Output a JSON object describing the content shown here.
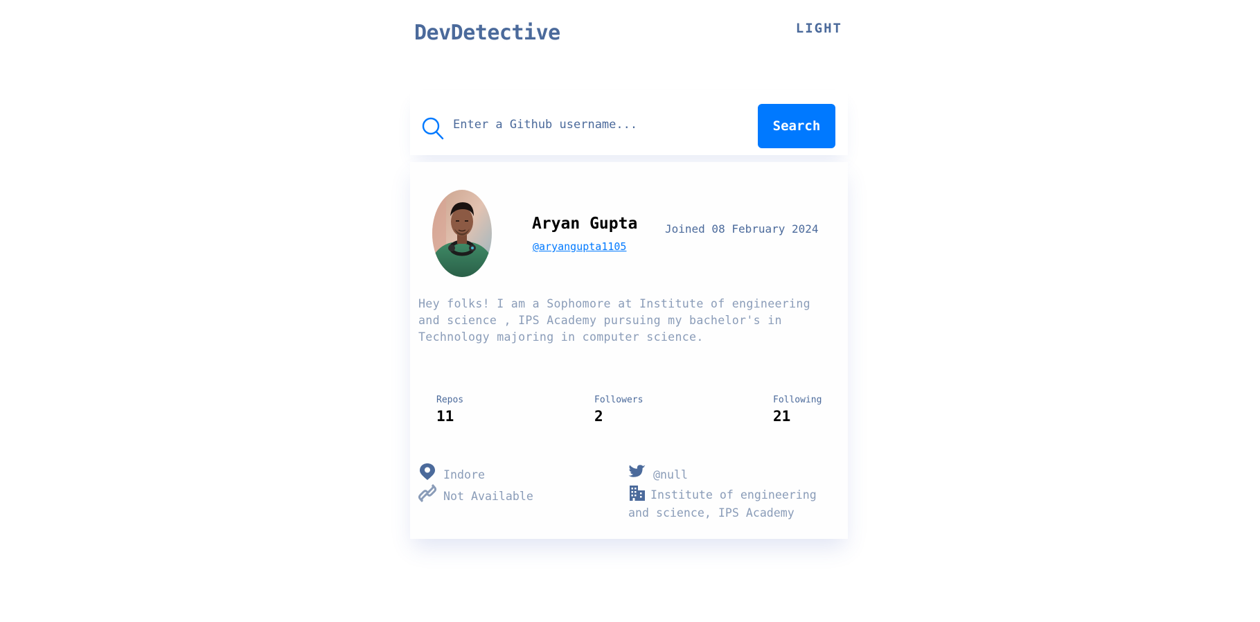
{
  "header": {
    "logo": "DevDetective",
    "mode_toggle": "LIGHT"
  },
  "search": {
    "placeholder": "Enter a Github username...",
    "value": "",
    "button_label": "Search"
  },
  "profile": {
    "name": "Aryan Gupta",
    "login": "@aryangupta1105",
    "joined": "Joined 08 February 2024",
    "bio": "Hey folks! I am a Sophomore at Institute of engineering and science , IPS Academy pursuing my bachelor's in Technology majoring in computer science.",
    "stats": {
      "repos": {
        "label": "Repos",
        "value": "11"
      },
      "followers": {
        "label": "Followers",
        "value": "2"
      },
      "following": {
        "label": "Following",
        "value": "21"
      }
    },
    "links": {
      "location": "Indore",
      "website": "Not Available",
      "twitter": "@null",
      "company": "Institute of engineering and science, IPS Academy"
    }
  },
  "colors": {
    "accent": "#0079ff",
    "heading": "#4b6a9b",
    "muted": "#8a9cb8",
    "text": "#000000",
    "background": "#ffffff"
  },
  "icons": {
    "search": "search-icon",
    "location": "location-pin-icon",
    "website": "link-icon",
    "twitter": "twitter-icon",
    "company": "building-icon"
  }
}
